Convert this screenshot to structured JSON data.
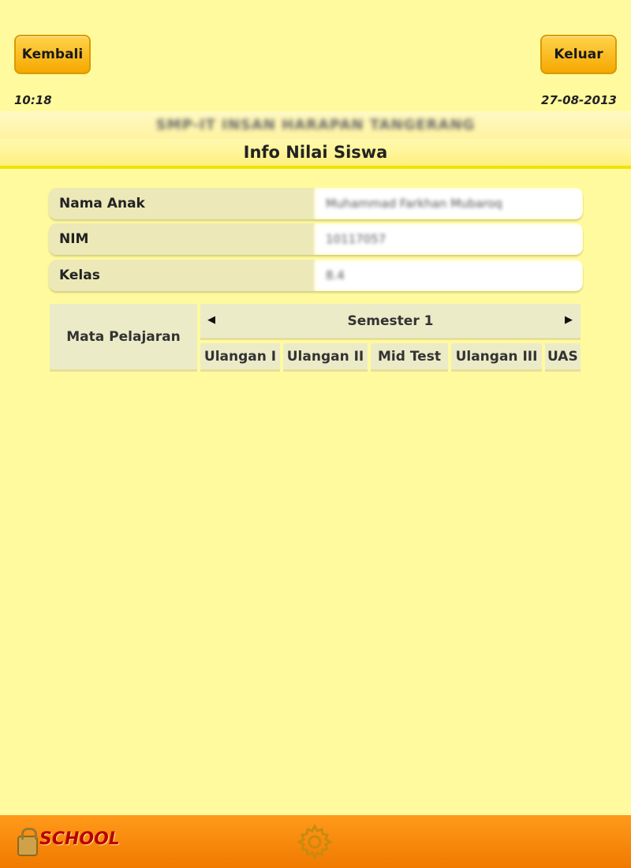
{
  "header": {
    "back_label": "Kembali",
    "exit_label": "Keluar",
    "time": "10:18",
    "date": "27-08-2013",
    "school_name": "SMP-IT INSAN HARAPAN TANGERANG",
    "page_title": "Info Nilai Siswa"
  },
  "student_info": {
    "name_label": "Nama Anak",
    "name_value": "Muhammad Farkhan Mubaroq",
    "nim_label": "NIM",
    "nim_value": "10117057",
    "class_label": "Kelas",
    "class_value": "8.4"
  },
  "grades_table": {
    "subject_header": "Mata Pelajaran",
    "semester_label": "Semester 1",
    "columns": [
      "Ulangan I",
      "Ulangan II",
      "Mid Test",
      "Ulangan III",
      "UAS"
    ],
    "prev_icon": "triangle-left-icon",
    "next_icon": "triangle-right-icon"
  },
  "footer": {
    "logo_text": "SCHOOL",
    "settings_icon": "gear-icon"
  },
  "colors": {
    "background": "#fffa9e",
    "button": "#f6a800",
    "footer": "#f07a00",
    "label_bg": "#ece8b8"
  }
}
